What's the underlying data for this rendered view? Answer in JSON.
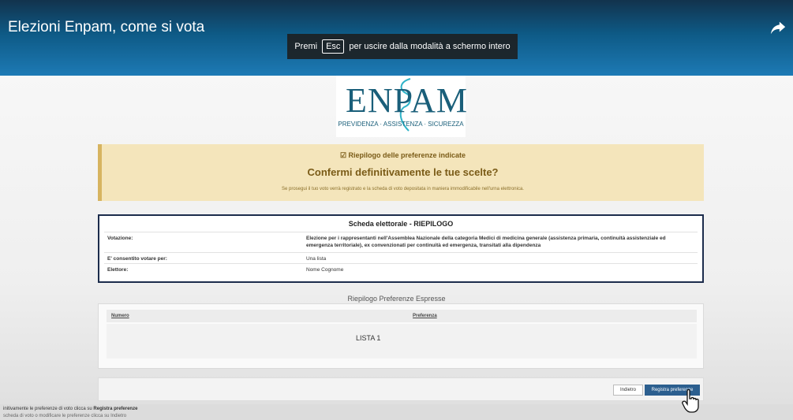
{
  "video": {
    "title": "Elezioni Enpam, come si vota",
    "toast_pre": "Premi",
    "toast_key": "Esc",
    "toast_post": "per uscire dalla modalità a schermo intero"
  },
  "logo": {
    "text": "ENPAM",
    "subtitle": "PREVIDENZA · ASSISTENZA · SICUREZZA",
    "color": "#1a5f7a"
  },
  "confirm": {
    "heading": "☑ Riepilogo delle preferenze indicate",
    "title": "Confermi definitivamente le tue scelte?",
    "note": "Se prosegui il tuo voto verrà registrato e la scheda di voto depositata in maniera immodificabile nell'urna elettronica."
  },
  "ballot": {
    "title": "Scheda elettorale - RIEPILOGO",
    "rows": [
      {
        "label": "Votazione:",
        "value": "Elezione per i rappresentanti nell'Assemblea Nazionale della categoria Medici di medicina generale (assistenza primaria, continuità assistenziale ed emergenza territoriale), ex convenzionati per continuità ed emergenza, transitati alla dipendenza"
      },
      {
        "label": "E' consentito votare per:",
        "value": "Una lista"
      },
      {
        "label": "Elettore:",
        "value": "Nome Cognome"
      }
    ]
  },
  "preferences": {
    "title": "Riepilogo Preferenze Espresse",
    "col_number": "Numero",
    "col_pref": "Preferenza",
    "value": "LISTA 1"
  },
  "actions": {
    "back": "Indietro",
    "register": "Registra preferenze"
  },
  "footer": {
    "hint_pre": "initivamente le preferenze di voto clicca su",
    "hint_bold": "Registra preferenze",
    "hint_line2": "scheda di voto o modificare le preferenze clicca su Indietro"
  }
}
